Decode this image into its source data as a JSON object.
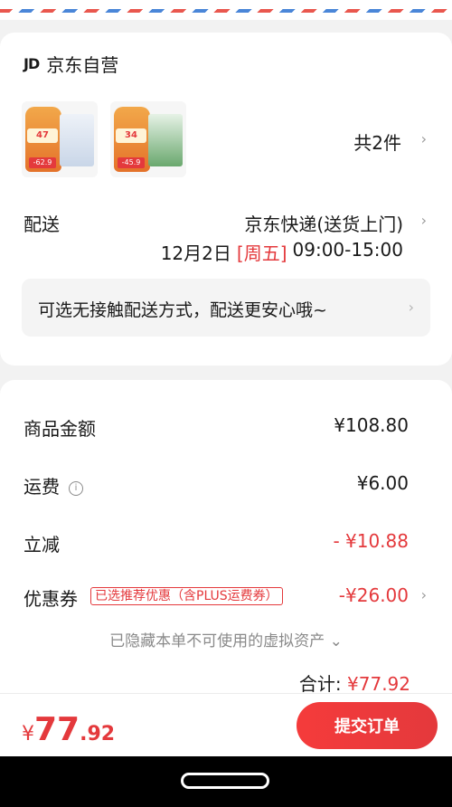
{
  "store": {
    "logo": "JD",
    "name": "京东自营"
  },
  "products": [
    {
      "price_tag": "47",
      "promo": "-62.9"
    },
    {
      "price_tag": "34",
      "promo": "-45.9"
    }
  ],
  "item_count": "共2件",
  "delivery": {
    "label": "配送",
    "method": "京东快递(送货上门)",
    "date": "12月2日",
    "weekday": "[周五]",
    "time": "09:00-15:00",
    "contactless_text": "可选无接触配送方式，配送更安心哦~"
  },
  "summary": {
    "goods_label": "商品金额",
    "goods_value": "¥108.80",
    "shipping_label": "运费",
    "shipping_value": "¥6.00",
    "discount_label": "立减",
    "discount_value": "- ¥10.88",
    "coupon_label": "优惠券",
    "coupon_badge": "已选推荐优惠（含PLUS运费券）",
    "coupon_value": "-¥26.00",
    "hidden_assets": "已隐藏本单不可使用的虚拟资产",
    "total_label": "合计:",
    "total_value": "¥77.92"
  },
  "footer": {
    "currency": "¥",
    "price_int": "77",
    "price_dec": ".92",
    "submit_label": "提交订单"
  },
  "colors": {
    "accent": "#e4393c",
    "airmail_red": "#e9574e",
    "airmail_blue": "#4a86d8"
  }
}
